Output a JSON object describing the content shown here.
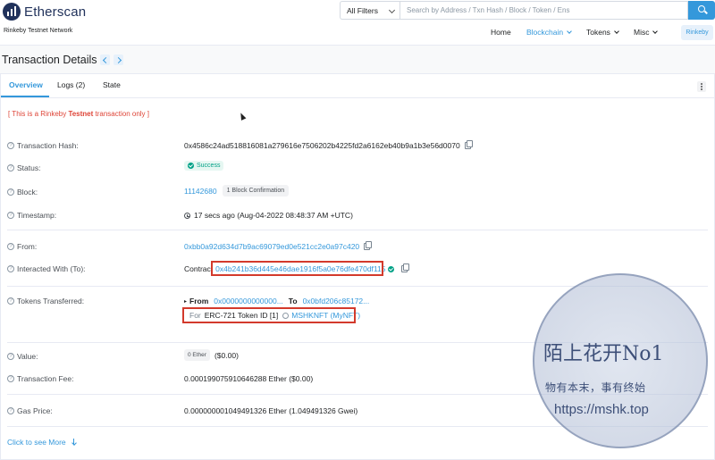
{
  "header": {
    "logo_text": "Etherscan",
    "network": "Rinkeby Testnet Network",
    "filter": "All Filters",
    "search_placeholder": "Search by Address / Txn Hash / Block / Token / Ens",
    "nav": [
      {
        "label": "Home"
      },
      {
        "label": "Blockchain"
      },
      {
        "label": "Tokens"
      },
      {
        "label": "Misc"
      }
    ],
    "network_button": "Rinkeby",
    "colors": {
      "accent": "#3498db",
      "brand": "#21325b"
    }
  },
  "page": {
    "title": "Transaction Details"
  },
  "tabs": [
    {
      "label": "Overview"
    },
    {
      "label": "Logs (2)"
    },
    {
      "label": "State"
    }
  ],
  "notice": {
    "prefix": "[ This is a Rinkeby ",
    "bold": "Testnet",
    "suffix": " transaction only ]"
  },
  "details": {
    "tx_hash_label": "Transaction Hash:",
    "tx_hash": "0x4586c24ad518816081a279616e7506202b4225fd2a6162eb40b9a1b3e56d0070",
    "status_label": "Status:",
    "status": "Success",
    "block_label": "Block:",
    "block": "11142680",
    "block_confirmation": "1 Block Confirmation",
    "timestamp_label": "Timestamp:",
    "timestamp": "17 secs ago (Aug-04-2022 08:48:37 AM +UTC)",
    "from_label": "From:",
    "from": "0xbb0a92d634d7b9ac69079ed0e521cc2e0a97c420",
    "to_label": "Interacted With (To):",
    "to_prefix": "Contract",
    "to": "0x4b241b36d445e46dae1916f5a0e76dfe470df115",
    "tokens_label": "Tokens Transferred:",
    "tokens_from_label": "From",
    "tokens_from": "0x0000000000000...",
    "tokens_to_label": "To",
    "tokens_to": "0x0bfd206c85172...",
    "tokens_for": "For",
    "tokens_type": "ERC-721 Token ID [1]",
    "tokens_name": "MSHKNFT (MyNFT)",
    "value_label": "Value:",
    "value_badge": "0 Ether",
    "value_usd": "($0.00)",
    "fee_label": "Transaction Fee:",
    "fee": "0.000199075910646288 Ether ($0.00)",
    "gas_label": "Gas Price:",
    "gas": "0.000000001049491326 Ether (1.049491326 Gwei)",
    "more": "Click to see More"
  },
  "watermark": {
    "title": "陌上花开No1",
    "subtitle": "物有本末，事有终始",
    "url": "https://mshk.top"
  }
}
